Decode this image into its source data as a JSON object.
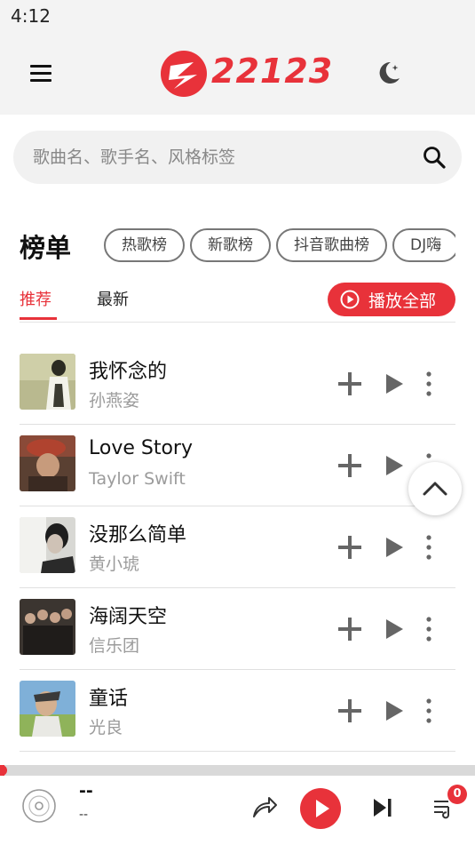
{
  "status_bar": {
    "time": "4:12"
  },
  "header": {
    "logo_text": "22123",
    "logo_icon": "brand-z-logo",
    "menu_icon": "hamburger-icon",
    "theme_icon": "moon-icon"
  },
  "search": {
    "placeholder": "歌曲名、歌手名、风格标签",
    "icon": "search-icon"
  },
  "charts": {
    "title": "榜单",
    "chips": [
      "热歌榜",
      "新歌榜",
      "抖音歌曲榜",
      "DJ嗨"
    ]
  },
  "tabs": {
    "recommend": "推荐",
    "newest": "最新"
  },
  "play_all": {
    "label": "播放全部"
  },
  "songs": [
    {
      "title": "我怀念的",
      "artist": "孙燕姿"
    },
    {
      "title": "Love Story",
      "artist": "Taylor Swift"
    },
    {
      "title": "没那么简单",
      "artist": "黄小琥"
    },
    {
      "title": "海阔天空",
      "artist": "信乐团"
    },
    {
      "title": "童话",
      "artist": "光良"
    }
  ],
  "player": {
    "title": "--",
    "artist": "--",
    "queue_count": "0",
    "progress": 0.01
  },
  "colors": {
    "accent": "#e8323a",
    "header_bg": "#f3f3f3",
    "muted_text": "#9b9b9b"
  }
}
